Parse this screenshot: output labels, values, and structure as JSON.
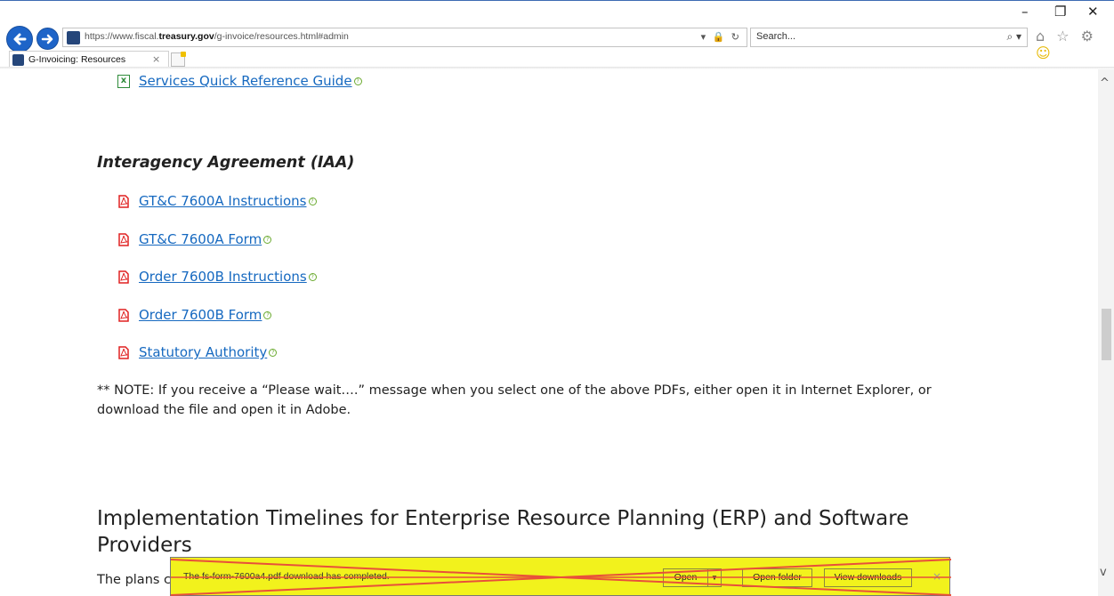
{
  "browser": {
    "url_prefix": "https://www.fiscal.",
    "url_domain": "treasury.gov",
    "url_suffix": "/g-invoice/resources.html#admin",
    "addr_icons": "▾ 🔒 ↻",
    "search_placeholder": "Search...",
    "search_glyph": "⌕ ▾",
    "tab_title": "G-Invoicing: Resources",
    "tab_close": "×",
    "toolbar_icons": "⌂ ☆ ⚙",
    "smile": "☺",
    "window": {
      "minimize": "–",
      "restore": "❐",
      "close": "✕"
    },
    "scroll_up": "^",
    "scroll_down": "v"
  },
  "page": {
    "services_link": "Services Quick Reference Guide",
    "iaa_heading": "Interagency Agreement (IAA)",
    "iaa_links": [
      "GT&C 7600A Instructions",
      "GT&C 7600A Form",
      "Order 7600B Instructions",
      "Order 7600B Form",
      "Statutory Authority"
    ],
    "note": "** NOTE: If you receive a “Please wait….” message when you select one of the above PDFs, either open it in Internet Explorer, or download the file and open it in Adobe.",
    "impl_heading": "Implementation Timelines for Enterprise Resource Planning (ERP) and Software Providers",
    "plans_text": "The plans c"
  },
  "download_bar": {
    "message": "The fs-form-7600a4.pdf download has completed.",
    "open_label": "Open",
    "open_arrow": "▼",
    "open_folder_label": "Open folder",
    "view_downloads_label": "View downloads",
    "close": "×"
  }
}
